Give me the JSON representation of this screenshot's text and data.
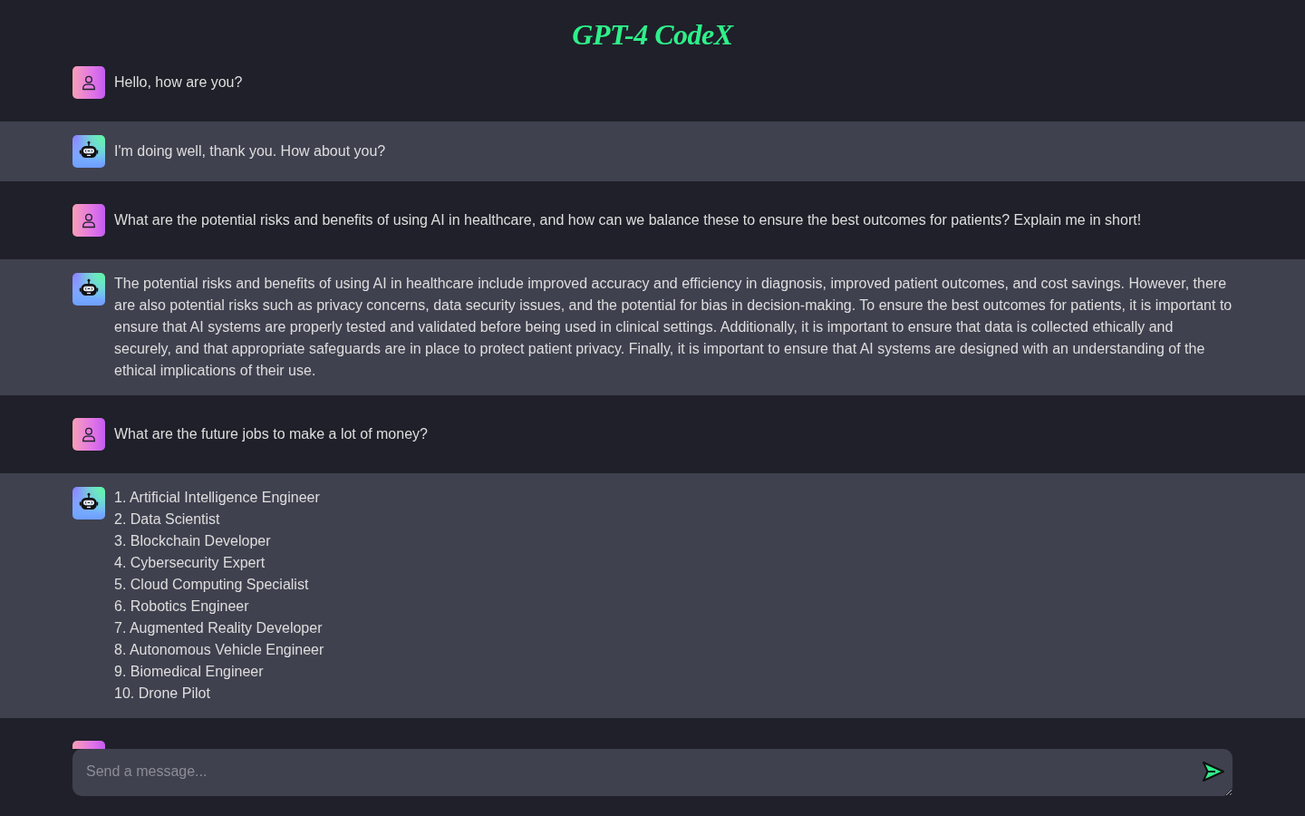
{
  "header": {
    "title": "GPT-4 CodeX"
  },
  "messages": [
    {
      "bot": false,
      "kind": "text",
      "text": "Hello, how are you?"
    },
    {
      "bot": true,
      "kind": "text",
      "text": "I'm doing well, thank you. How about you?"
    },
    {
      "bot": false,
      "kind": "text",
      "text": "What are the potential risks and benefits of using AI in healthcare, and how can we balance these to ensure the best outcomes for patients? Explain me in short!"
    },
    {
      "bot": true,
      "kind": "text",
      "text": "The potential risks and benefits of using AI in healthcare include improved accuracy and efficiency in diagnosis, improved patient outcomes, and cost savings. However, there are also potential risks such as privacy concerns, data security issues, and the potential for bias in decision-making. To ensure the best outcomes for patients, it is important to ensure that AI systems are properly tested and validated before being used in clinical settings. Additionally, it is important to ensure that data is collected ethically and securely, and that appropriate safeguards are in place to protect patient privacy. Finally, it is important to ensure that AI systems are designed with an understanding of the ethical implications of their use."
    },
    {
      "bot": false,
      "kind": "text",
      "text": "What are the future jobs to make a lot of money?"
    },
    {
      "bot": true,
      "kind": "list",
      "items": [
        "1. Artificial Intelligence Engineer",
        "2. Data Scientist",
        "3. Blockchain Developer",
        "4. Cybersecurity Expert",
        "5. Cloud Computing Specialist",
        "6. Robotics Engineer",
        "7. Augmented Reality Developer",
        "8. Autonomous Vehicle Engineer",
        "9. Biomedical Engineer",
        "10. Drone Pilot"
      ]
    },
    {
      "bot": false,
      "kind": "hidden"
    }
  ],
  "composer": {
    "placeholder": "Send a message..."
  }
}
